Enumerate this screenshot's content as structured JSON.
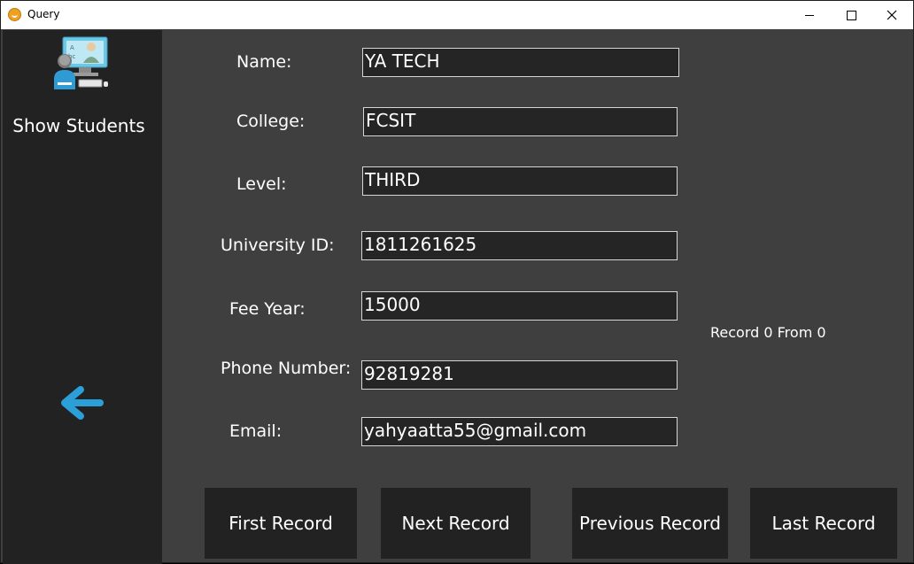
{
  "window": {
    "title": "Query"
  },
  "sidebar": {
    "title": "Show Students",
    "icon": "student-computer-icon",
    "back_icon": "arrow-left-icon"
  },
  "form": {
    "name": {
      "label": "Name:",
      "value": "YA TECH"
    },
    "college": {
      "label": "College:",
      "value": "FCSIT"
    },
    "level": {
      "label": "Level:",
      "value": "THIRD"
    },
    "university_id": {
      "label": "University ID:",
      "value": "1811261625"
    },
    "fee_year": {
      "label": "Fee Year:",
      "value": "15000"
    },
    "phone": {
      "label": "Phone Number:",
      "value": "92819281"
    },
    "email": {
      "label": "Email:",
      "value": "yahyaatta55@gmail.com"
    }
  },
  "record_info": "Record 0 From 0",
  "buttons": {
    "first": "First Record",
    "next": "Next Record",
    "previous": "Previous Record",
    "last": "Last Record"
  },
  "colors": {
    "background": "#3f3f3f",
    "sidebar": "#222222",
    "field": "#252525",
    "accent": "#2a9fd8"
  }
}
